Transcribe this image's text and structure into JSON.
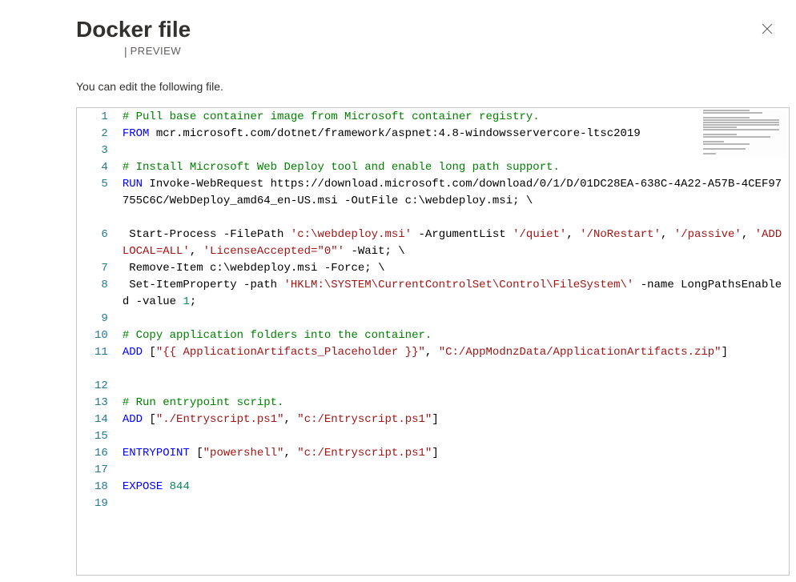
{
  "header": {
    "title": "Docker file",
    "preview_label": "PREVIEW"
  },
  "description": "You can edit the following file.",
  "code": {
    "lines": [
      {
        "num": 1,
        "segs": [
          {
            "t": "# Pull base container image from Microsoft container registry.",
            "c": "comment"
          }
        ]
      },
      {
        "num": 2,
        "segs": [
          {
            "t": "FROM",
            "c": "keyword"
          },
          {
            "t": " mcr.microsoft.com/dotnet/framework/aspnet:4.8-windowsservercore-ltsc2019",
            "c": "plain"
          }
        ]
      },
      {
        "num": 3,
        "segs": []
      },
      {
        "num": 4,
        "segs": [
          {
            "t": "# Install Microsoft Web Deploy tool and enable long path support.",
            "c": "comment"
          }
        ]
      },
      {
        "num": 5,
        "segs": [
          {
            "t": "RUN",
            "c": "keyword"
          },
          {
            "t": " Invoke-WebRequest https://download.microsoft.com/download/0/1/D/01DC28EA-638C-4A22-A57B-4CEF97755C6C/WebDeploy_amd64_en-US.msi -OutFile c:\\webdeploy.msi; \\",
            "c": "plain"
          }
        ]
      },
      {
        "num": 6,
        "segs": [
          {
            "t": " Start-Process -FilePath ",
            "c": "plain"
          },
          {
            "t": "'c:\\webdeploy.msi'",
            "c": "string"
          },
          {
            "t": " -ArgumentList ",
            "c": "plain"
          },
          {
            "t": "'/quiet'",
            "c": "string"
          },
          {
            "t": ", ",
            "c": "plain"
          },
          {
            "t": "'/NoRestart'",
            "c": "string"
          },
          {
            "t": ", ",
            "c": "plain"
          },
          {
            "t": "'/passive'",
            "c": "string"
          },
          {
            "t": ", ",
            "c": "plain"
          },
          {
            "t": "'ADDLOCAL=ALL'",
            "c": "string"
          },
          {
            "t": ", ",
            "c": "plain"
          },
          {
            "t": "'LicenseAccepted=\"0\"'",
            "c": "string"
          },
          {
            "t": " -Wait; \\",
            "c": "plain"
          }
        ]
      },
      {
        "num": 7,
        "segs": [
          {
            "t": " Remove-Item c:\\webdeploy.msi -Force; \\",
            "c": "plain"
          }
        ]
      },
      {
        "num": 8,
        "segs": [
          {
            "t": " Set-ItemProperty -path ",
            "c": "plain"
          },
          {
            "t": "'HKLM:\\SYSTEM\\CurrentControlSet\\Control\\FileSystem\\'",
            "c": "string"
          },
          {
            "t": " -name LongPathsEnabled -value ",
            "c": "plain"
          },
          {
            "t": "1",
            "c": "number"
          },
          {
            "t": ";",
            "c": "plain"
          }
        ]
      },
      {
        "num": 9,
        "segs": []
      },
      {
        "num": 10,
        "segs": [
          {
            "t": "# Copy application folders into the container.",
            "c": "comment"
          }
        ]
      },
      {
        "num": 11,
        "segs": [
          {
            "t": "ADD",
            "c": "keyword"
          },
          {
            "t": " [",
            "c": "plain"
          },
          {
            "t": "\"{{ ApplicationArtifacts_Placeholder }}\"",
            "c": "string"
          },
          {
            "t": ", ",
            "c": "plain"
          },
          {
            "t": "\"C:/AppModnzData/ApplicationArtifacts.zip\"",
            "c": "string"
          },
          {
            "t": "]",
            "c": "plain"
          }
        ]
      },
      {
        "num": 12,
        "segs": []
      },
      {
        "num": 13,
        "segs": [
          {
            "t": "# Run entrypoint script.",
            "c": "comment"
          }
        ]
      },
      {
        "num": 14,
        "segs": [
          {
            "t": "ADD",
            "c": "keyword"
          },
          {
            "t": " [",
            "c": "plain"
          },
          {
            "t": "\"./Entryscript.ps1\"",
            "c": "string"
          },
          {
            "t": ", ",
            "c": "plain"
          },
          {
            "t": "\"c:/Entryscript.ps1\"",
            "c": "string"
          },
          {
            "t": "]",
            "c": "plain"
          }
        ]
      },
      {
        "num": 15,
        "segs": []
      },
      {
        "num": 16,
        "segs": [
          {
            "t": "ENTRYPOINT",
            "c": "keyword"
          },
          {
            "t": " [",
            "c": "plain"
          },
          {
            "t": "\"powershell\"",
            "c": "string"
          },
          {
            "t": ", ",
            "c": "plain"
          },
          {
            "t": "\"c:/Entryscript.ps1\"",
            "c": "string"
          },
          {
            "t": "]",
            "c": "plain"
          }
        ]
      },
      {
        "num": 17,
        "segs": []
      },
      {
        "num": 18,
        "segs": [
          {
            "t": "EXPOSE",
            "c": "keyword"
          },
          {
            "t": " ",
            "c": "plain"
          },
          {
            "t": "844",
            "c": "number"
          }
        ]
      },
      {
        "num": 19,
        "segs": []
      }
    ],
    "wrap_extra": {
      "5": 2,
      "6": 1,
      "8": 1,
      "11": 1
    }
  }
}
